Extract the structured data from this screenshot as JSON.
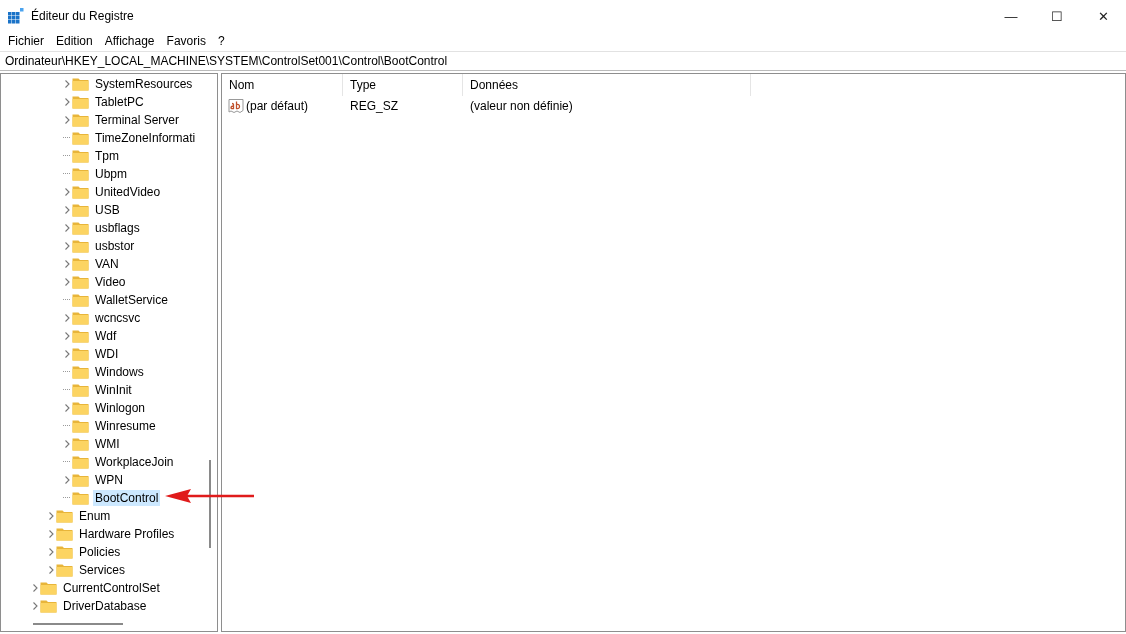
{
  "window": {
    "title": "Éditeur du Registre",
    "controls": [
      "—",
      "☐",
      "✕"
    ]
  },
  "menu": [
    "Fichier",
    "Edition",
    "Affichage",
    "Favoris",
    "?"
  ],
  "address": "Ordinateur\\HKEY_LOCAL_MACHINE\\SYSTEM\\ControlSet001\\Control\\BootControl",
  "tree": {
    "items": [
      {
        "children": [
          {
            "children": [
              {
                "label": "SystemResources",
                "expandable": true,
                "selected": false
              },
              {
                "label": "TabletPC",
                "expandable": true,
                "selected": false
              },
              {
                "label": "Terminal Server",
                "expandable": true,
                "selected": false
              },
              {
                "label": "TimeZoneInformati",
                "expandable": false,
                "selected": false
              },
              {
                "label": "Tpm",
                "expandable": false,
                "selected": false
              },
              {
                "label": "Ubpm",
                "expandable": false,
                "selected": false
              },
              {
                "label": "UnitedVideo",
                "expandable": true,
                "selected": false
              },
              {
                "label": "USB",
                "expandable": true,
                "selected": false
              },
              {
                "label": "usbflags",
                "expandable": true,
                "selected": false
              },
              {
                "label": "usbstor",
                "expandable": true,
                "selected": false
              },
              {
                "label": "VAN",
                "expandable": true,
                "selected": false
              },
              {
                "label": "Video",
                "expandable": true,
                "selected": false
              },
              {
                "label": "WalletService",
                "expandable": false,
                "selected": false
              },
              {
                "label": "wcncsvc",
                "expandable": true,
                "selected": false
              },
              {
                "label": "Wdf",
                "expandable": true,
                "selected": false
              },
              {
                "label": "WDI",
                "expandable": true,
                "selected": false
              },
              {
                "label": "Windows",
                "expandable": false,
                "selected": false
              },
              {
                "label": "WinInit",
                "expandable": false,
                "selected": false
              },
              {
                "label": "Winlogon",
                "expandable": true,
                "selected": false
              },
              {
                "label": "Winresume",
                "expandable": false,
                "selected": false
              },
              {
                "label": "WMI",
                "expandable": true,
                "selected": false
              },
              {
                "label": "WorkplaceJoin",
                "expandable": false,
                "selected": false
              },
              {
                "label": "WPN",
                "expandable": true,
                "selected": false
              },
              {
                "label": "BootControl",
                "expandable": false,
                "selected": true
              }
            ]
          },
          {
            "label": "Enum",
            "expandable": true,
            "selected": false
          },
          {
            "label": "Hardware Profiles",
            "expandable": true,
            "selected": false
          },
          {
            "label": "Policies",
            "expandable": true,
            "selected": false
          },
          {
            "label": "Services",
            "expandable": true,
            "selected": false
          }
        ]
      },
      {
        "label": "CurrentControlSet",
        "expandable": true,
        "selected": false
      },
      {
        "label": "DriverDatabase",
        "expandable": true,
        "selected": false
      }
    ]
  },
  "table": {
    "columns": [
      "Nom",
      "Type",
      "Données"
    ],
    "rows": [
      {
        "name": "(par défaut)",
        "type": "REG_SZ",
        "data": "(valeur non définie)"
      }
    ]
  }
}
